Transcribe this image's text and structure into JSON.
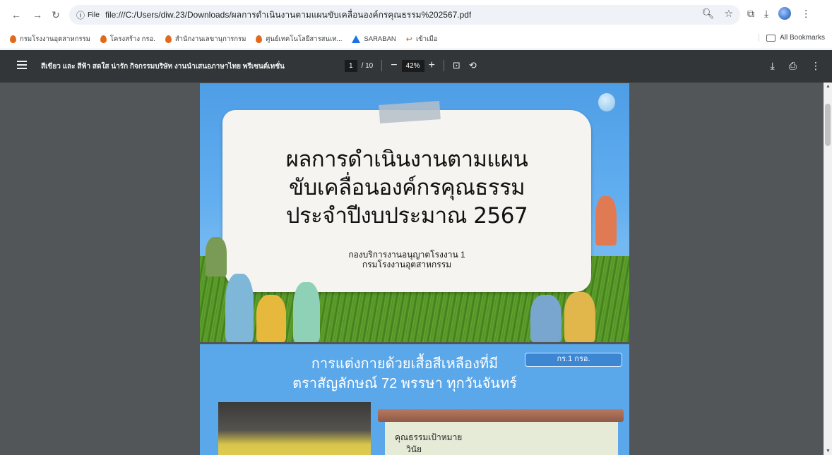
{
  "browser": {
    "url": "file:///C:/Users/diw.23/Downloads/ผลการดำเนินงานตามแผนขับเคลื่อนองค์กรคุณธรรม%202567.pdf",
    "file_chip_label": "File",
    "bookmarks": [
      {
        "label": "กรมโรงงานอุตสาหกรรม",
        "icon": "drop"
      },
      {
        "label": "โครงสร้าง กรอ.",
        "icon": "drop"
      },
      {
        "label": "สำนักงานเลขานุการกรม",
        "icon": "drop"
      },
      {
        "label": "ศูนย์เทคโนโลยีสารสนเท...",
        "icon": "drop"
      },
      {
        "label": "SARABAN",
        "icon": "tri"
      },
      {
        "label": "เข้าเมือ",
        "icon": "hook"
      }
    ],
    "all_bookmarks_label": "All Bookmarks"
  },
  "pdf_toolbar": {
    "title": "สีเขียว และ สีฟ้า สดใส น่ารัก กิจกรรมบริษัท งานนำเสนอภาษาไทย พรีเซนต์เทชั่น",
    "current_page": "1",
    "total_pages": "/ 10",
    "zoom": "42%"
  },
  "page1": {
    "title_lines": [
      "ผลการดำเนินงานตามแผน",
      "ขับเคลื่อนองค์กรคุณธรรม",
      "ประจำปีงบประมาณ 2567"
    ],
    "subtitle_lines": [
      "กองบริการงานอนุญาตโรงงาน 1",
      "กรมโรงงานอุตสาหกรรม"
    ]
  },
  "page2": {
    "title_lines": [
      "การแต่งกายด้วยเสื้อสีเหลืองที่มี",
      "ตราสัญลักษณ์ 72 พรรษา ทุกวันจันทร์"
    ],
    "badge": "กร.1 กรอ.",
    "board_lines": [
      "คุณธรรมเป้าหมาย",
      "วินัย"
    ]
  },
  "colors": {
    "pdf_toolbar_bg": "#323639",
    "viewer_bg": "#525659",
    "sky": "#5aa7ea"
  }
}
